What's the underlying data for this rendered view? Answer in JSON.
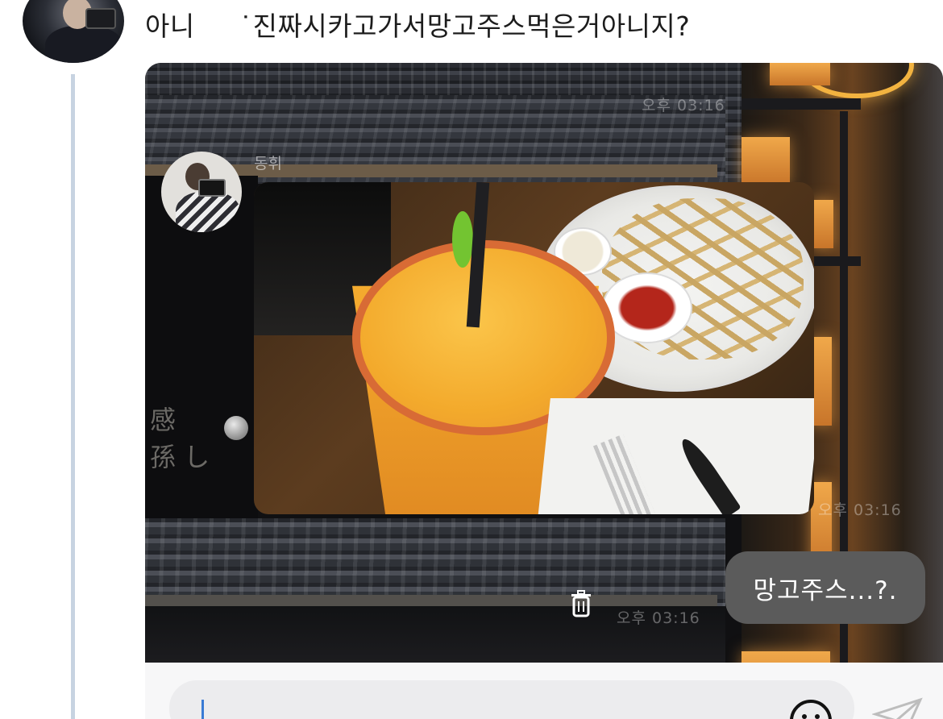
{
  "tweet": {
    "text": "아니     ˙진짜시카고가서망고주스먹은거아니지?"
  },
  "chat": {
    "partner_name": "동휘",
    "time_top": "오후 03:16",
    "time_right": "오후 03:16",
    "time_bottom": "오후 03:16",
    "reply_text": "망고주스...?.",
    "left_sign": "感\n孫 し"
  },
  "icons": {
    "trash": "trash-icon",
    "emoji": "emoji-icon",
    "send": "send-icon"
  },
  "colors": {
    "thread_line": "#c7d3e1",
    "bubble_bg": "#5b5b5b",
    "caret": "#3a7bd5"
  }
}
